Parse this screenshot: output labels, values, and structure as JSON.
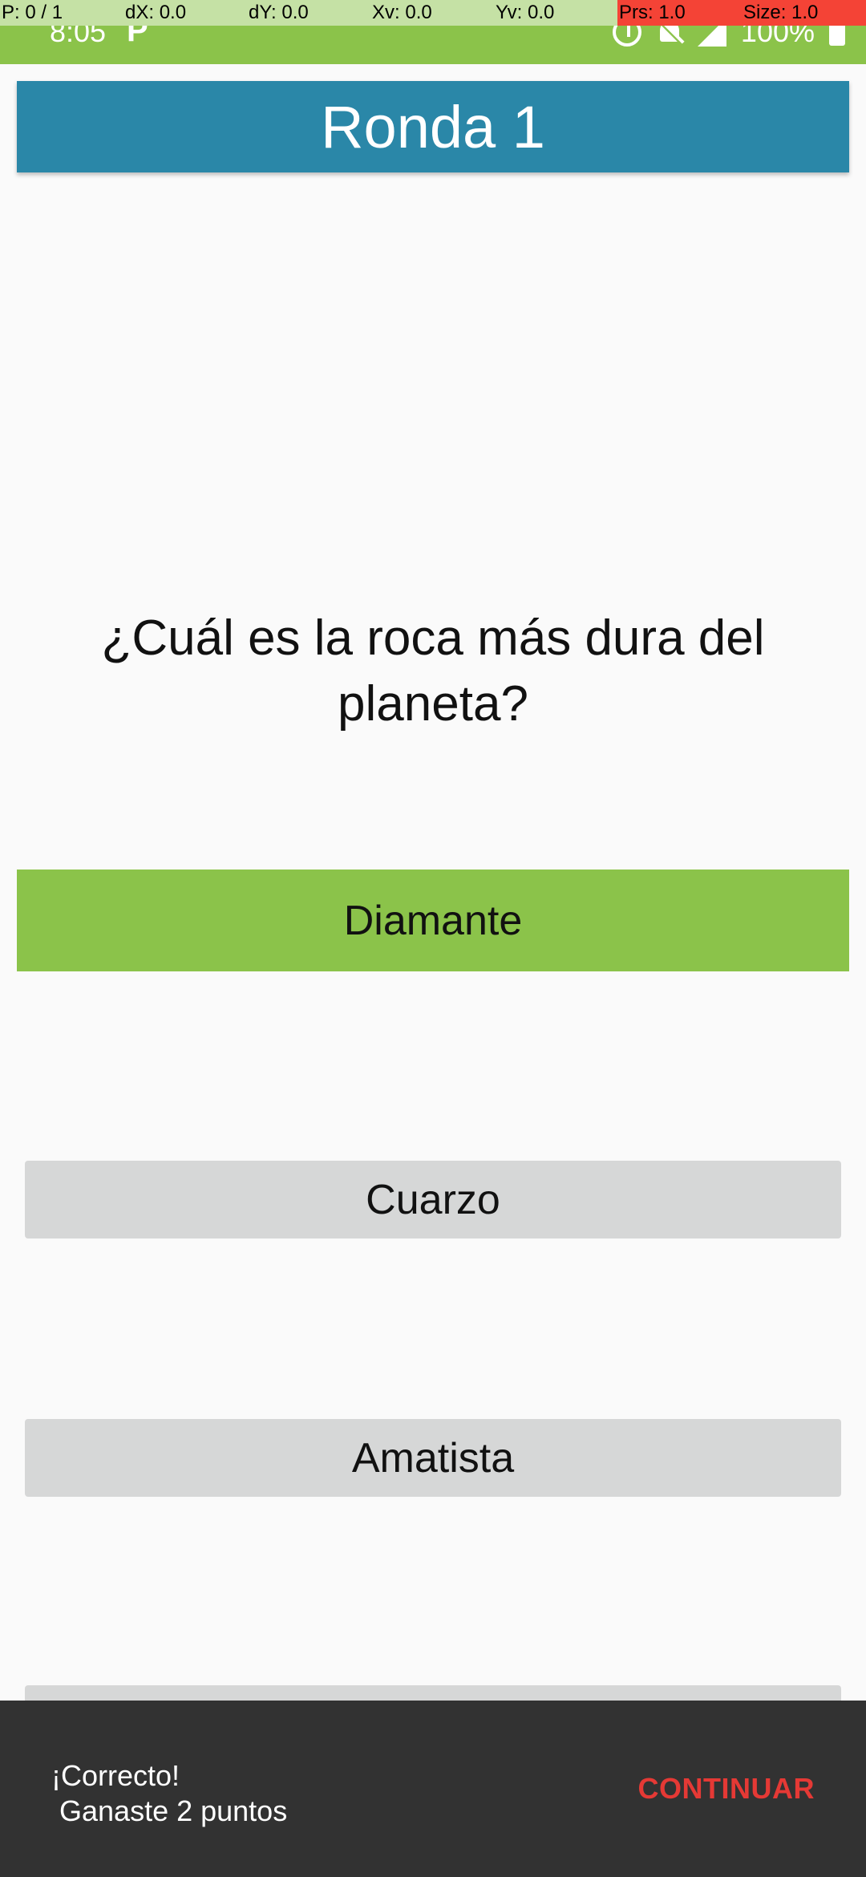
{
  "status_bar": {
    "time": "8:05",
    "app_icon": "P",
    "battery_text": "100%",
    "icons": [
      "alarm-icon",
      "notifications-off-icon",
      "signal-icon",
      "battery-charging-icon"
    ]
  },
  "debug_overlay": {
    "pointer": "P: 0 / 1",
    "dx": "dX: 0.0",
    "dy": "dY: 0.0",
    "xv": "Xv: 0.0",
    "yv": "Yv: 0.0",
    "prs": "Prs: 1.0",
    "size": "Size: 1.0"
  },
  "header": {
    "title": "Ronda 1"
  },
  "question": {
    "text": "¿Cuál es la roca más dura del planeta?"
  },
  "answers": [
    {
      "label": "Diamante",
      "state": "correct"
    },
    {
      "label": "Cuarzo",
      "state": "neutral"
    },
    {
      "label": "Amatista",
      "state": "neutral"
    },
    {
      "label": "",
      "state": "neutral"
    }
  ],
  "snackbar": {
    "message_line1": "¡Correcto!",
    "message_line2": " Ganaste 2 puntos",
    "action_label": "CONTINUAR"
  },
  "colors": {
    "status_bar": "#8bc34a",
    "header": "#2a87a8",
    "correct_answer": "#8bc34a",
    "neutral_answer": "#d6d7d7",
    "snackbar_bg": "#323232",
    "snackbar_action": "#e53935"
  }
}
